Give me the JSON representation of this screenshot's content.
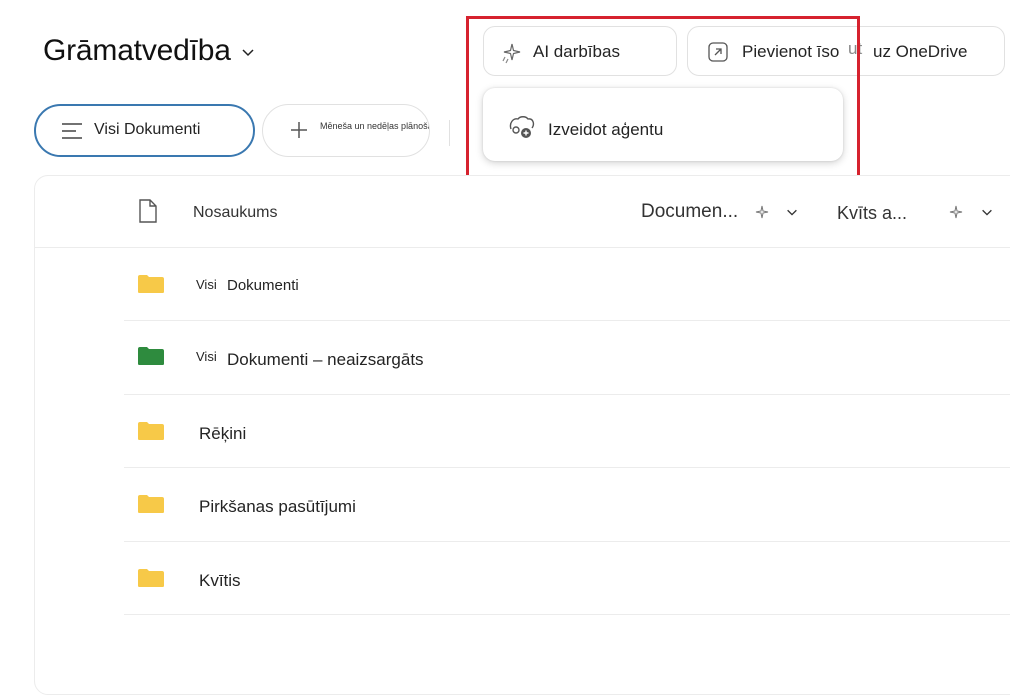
{
  "header": {
    "title": "Grāmatvedība"
  },
  "toolbar": {
    "ai_actions_label": "AI darbības",
    "add_shortcut_label": "Pievienot īso",
    "add_shortcut_fragment": "ut",
    "add_shortcut_suffix": "uz OneDrive"
  },
  "views": {
    "active_label": "Visi Dokumenti",
    "add_view_label": "Mēneša un nedēļas plānošanas kalendārs (Word)"
  },
  "popup": {
    "create_agent_label": "Izveidot aģentu"
  },
  "table": {
    "columns": {
      "name": "Nosaukums",
      "document": "Documen...",
      "receipt": "Kvīts a..."
    },
    "rows": [
      {
        "prefix": "Visi",
        "name": "Dokumenti",
        "folder_color": "#f7c948"
      },
      {
        "prefix": "Visi",
        "name": "Dokumenti – neaizsargāts",
        "folder_color": "#2e8b3e"
      },
      {
        "prefix": "",
        "name": "Rēķini",
        "folder_color": "#f7c948"
      },
      {
        "prefix": "",
        "name": "Pirkšanas pasūtījumi",
        "folder_color": "#f7c948"
      },
      {
        "prefix": "",
        "name": "Kvītis",
        "folder_color": "#f7c948"
      }
    ]
  },
  "colors": {
    "highlight": "#d6222e",
    "accent": "#3a78b0"
  },
  "icons": [
    "chevron-down-icon",
    "sparkle-icon",
    "shortcut-arrow-icon",
    "list-icon",
    "plus-icon",
    "agent-icon",
    "file-icon",
    "folder-icon"
  ]
}
